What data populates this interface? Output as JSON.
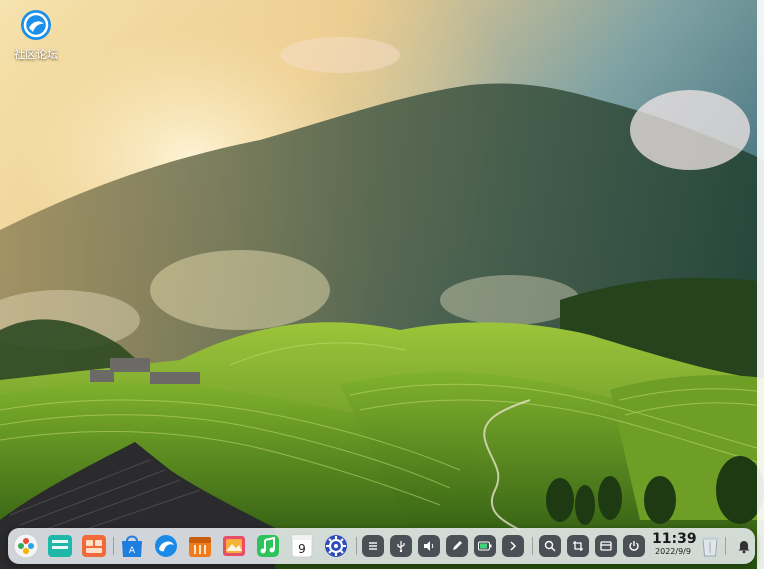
{
  "desktop": {
    "icons": [
      {
        "label": "社区论坛",
        "icon": "deepin-forum-icon"
      }
    ]
  },
  "dock": {
    "apps": [
      {
        "name": "launcher-icon"
      },
      {
        "name": "multitasking-view-icon"
      },
      {
        "name": "file-manager-icon"
      },
      {
        "name": "app-store-icon"
      },
      {
        "name": "browser-icon"
      },
      {
        "name": "archive-manager-icon"
      },
      {
        "name": "image-viewer-icon"
      },
      {
        "name": "music-icon"
      },
      {
        "name": "calendar-icon",
        "text": "9"
      },
      {
        "name": "control-center-icon"
      }
    ],
    "tray": [
      {
        "name": "list-icon"
      },
      {
        "name": "usb-icon"
      },
      {
        "name": "volume-icon"
      },
      {
        "name": "pen-icon"
      },
      {
        "name": "battery-icon"
      },
      {
        "name": "expand-arrow-icon"
      },
      {
        "name": "search-icon"
      },
      {
        "name": "screenshot-icon"
      },
      {
        "name": "show-desktop-icon"
      },
      {
        "name": "power-icon"
      }
    ],
    "clock": {
      "time": "11:39",
      "date": "2022/9/9"
    },
    "trash": {
      "name": "trash-icon"
    },
    "notification": {
      "name": "bell-icon"
    }
  }
}
